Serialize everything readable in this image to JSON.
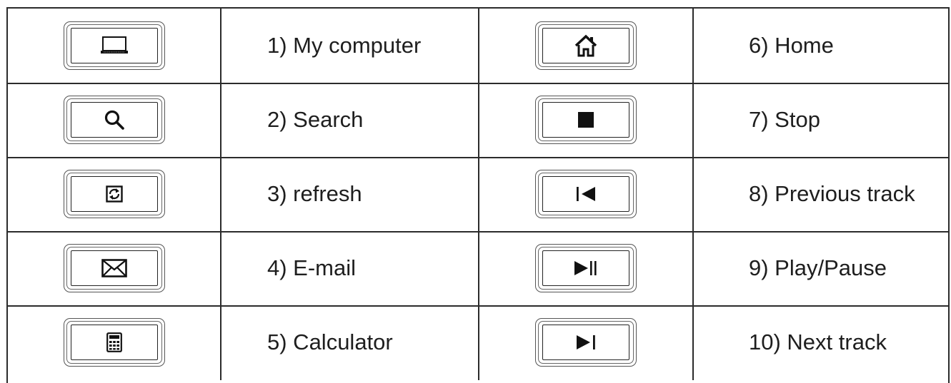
{
  "rows": [
    {
      "left": {
        "label": "1) My computer",
        "icon": "computer-icon"
      },
      "right": {
        "label": "6) Home",
        "icon": "home-icon"
      }
    },
    {
      "left": {
        "label": "2) Search",
        "icon": "search-icon"
      },
      "right": {
        "label": "7) Stop",
        "icon": "stop-icon"
      }
    },
    {
      "left": {
        "label": "3) refresh",
        "icon": "refresh-icon"
      },
      "right": {
        "label": "8) Previous track",
        "icon": "previous-track-icon"
      }
    },
    {
      "left": {
        "label": "4) E-mail",
        "icon": "email-icon"
      },
      "right": {
        "label": "9) Play/Pause",
        "icon": "play-pause-icon"
      }
    },
    {
      "left": {
        "label": "5) Calculator",
        "icon": "calculator-icon"
      },
      "right": {
        "label": "10) Next track",
        "icon": "next-track-icon"
      }
    }
  ]
}
